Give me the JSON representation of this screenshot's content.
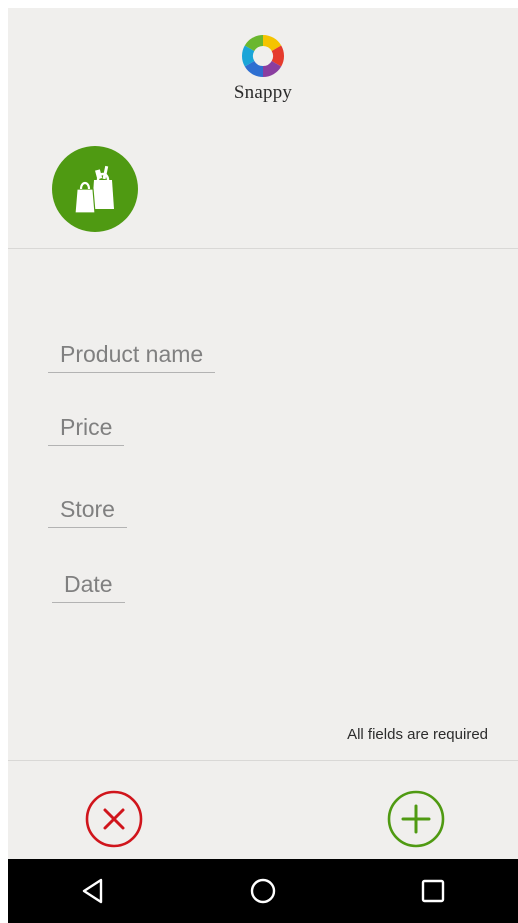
{
  "app": {
    "name": "Snappy",
    "logo_icon": "snappy-aperture-logo"
  },
  "category": {
    "icon": "shopping-bags-icon",
    "color": "#4f9a12"
  },
  "form": {
    "product_name_placeholder": "Product name",
    "price_placeholder": "Price",
    "store_placeholder": "Store",
    "date_placeholder": "Date",
    "required_note": "All fields are required"
  },
  "actions": {
    "cancel_icon": "cancel-circle-icon",
    "cancel_color": "#d0151c",
    "add_icon": "add-circle-icon",
    "add_color": "#4f9a12"
  },
  "navbar": {
    "back_icon": "back-triangle-icon",
    "home_icon": "home-circle-icon",
    "recents_icon": "recents-square-icon"
  }
}
